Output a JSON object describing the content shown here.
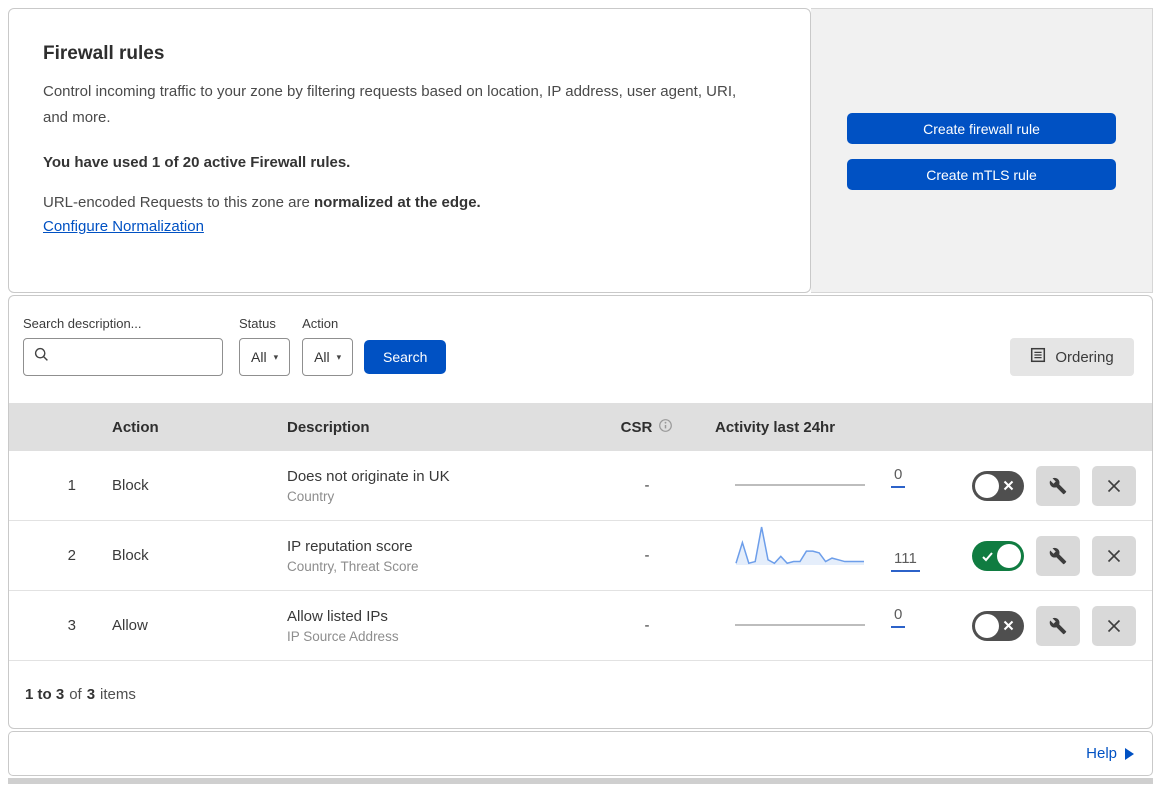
{
  "colors": {
    "primary_blue": "#0051c3",
    "toggle_on_green": "#107c41",
    "toggle_off_gray": "#4f4f4f",
    "sparkline_blue": "#6d9eea",
    "table_header_bg": "#dfdfdf",
    "panel_bg": "#f1f1f1"
  },
  "intro": {
    "title": "Firewall rules",
    "description": "Control incoming traffic to your zone by filtering requests based on location, IP address, user agent, URI, and more.",
    "usage_notice": "You have used 1 of 20 active Firewall rules.",
    "normalization_prefix": "URL-encoded Requests to this zone are ",
    "normalization_bold": "normalized at the edge.",
    "normalization_link": "Configure Normalization"
  },
  "actions_panel": {
    "buttons": [
      {
        "label": "Create firewall rule"
      },
      {
        "label": "Create mTLS rule"
      }
    ]
  },
  "filters": {
    "search_label": "Search description...",
    "search_value": "",
    "search_icon": "magnifier-icon",
    "status_label": "Status",
    "status_value": "All",
    "action_label": "Action",
    "action_value": "All",
    "caret": "▾",
    "search_button_label": "Search",
    "ordering_button_label": "Ordering",
    "ordering_icon": "list-page-icon"
  },
  "table": {
    "headers": {
      "action": "Action",
      "description": "Description",
      "csr": "CSR",
      "csr_info_icon": "info-icon",
      "activity": "Activity last 24hr"
    },
    "rows": [
      {
        "num": "1",
        "action": "Block",
        "description": "Does not originate in UK",
        "fields": "Country",
        "csr": "-",
        "activity_count": "0",
        "enabled": false,
        "sparkline": []
      },
      {
        "num": "2",
        "action": "Block",
        "description": "IP reputation score",
        "fields": "Country, Threat Score",
        "csr": "-",
        "activity_count": "111",
        "enabled": true,
        "sparkline": [
          1,
          13,
          1,
          2,
          22,
          3,
          1,
          5,
          1,
          2,
          2,
          8,
          8,
          7,
          2,
          4,
          3,
          2,
          2,
          2,
          2
        ]
      },
      {
        "num": "3",
        "action": "Allow",
        "description": "Allow listed IPs",
        "fields": "IP Source Address",
        "csr": "-",
        "activity_count": "0",
        "enabled": false,
        "sparkline": []
      }
    ],
    "footer": {
      "range": "1 to 3",
      "of": "of",
      "total": "3",
      "items": "items"
    }
  },
  "help": {
    "label": "Help"
  }
}
